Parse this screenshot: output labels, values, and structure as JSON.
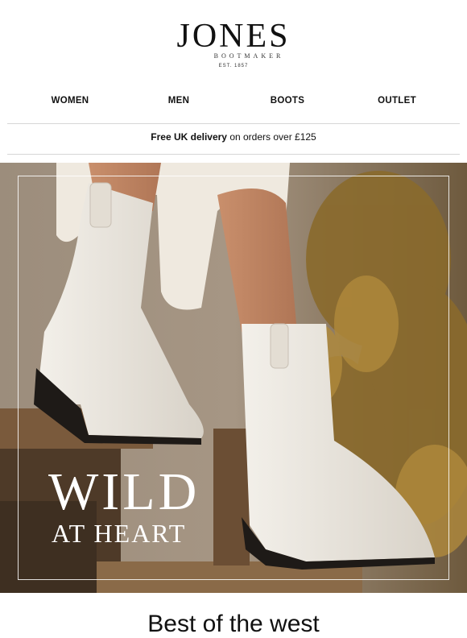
{
  "brand": {
    "name": "JONES",
    "subtitle": "BOOTMAKER",
    "established": "EST. 1857"
  },
  "nav": [
    {
      "label": "WOMEN"
    },
    {
      "label": "MEN"
    },
    {
      "label": "BOOTS"
    },
    {
      "label": "OUTLET"
    }
  ],
  "promo": {
    "bold": "Free UK delivery",
    "rest": "on orders over £125"
  },
  "hero": {
    "line1": "WILD",
    "line2": "AT HEART",
    "colors": {
      "boot": "#ece8e1",
      "foliage": "#8a6a2c",
      "wood": "#7a5a3c"
    }
  },
  "section": {
    "title": "Best of the west"
  }
}
